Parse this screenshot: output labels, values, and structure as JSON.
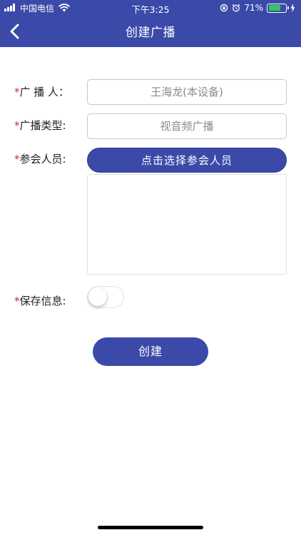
{
  "status_bar": {
    "carrier": "中国电信",
    "time": "下午3:25",
    "battery_percent_text": "71%",
    "battery_level": 0.71,
    "icons": [
      "signal-icon",
      "wifi-icon",
      "rotation-lock-icon",
      "alarm-icon",
      "battery-icon",
      "charging-icon"
    ]
  },
  "nav": {
    "back_icon": "chevron-left-icon",
    "title": "创建广播"
  },
  "form": {
    "required_mark": "*",
    "broadcaster": {
      "label": "广 播 人：",
      "value": "王海龙(本设备)"
    },
    "broadcast_type": {
      "label": "广播类型:",
      "value": "视音频广播"
    },
    "participants": {
      "label": "参会人员:",
      "button_label": "点击选择参会人员",
      "selected": []
    },
    "save_info": {
      "label": "保存信息:",
      "enabled": false
    }
  },
  "actions": {
    "create_label": "创建"
  },
  "colors": {
    "primary": "#3b4aa8",
    "required": "#e02020",
    "battery": "#35c759"
  }
}
